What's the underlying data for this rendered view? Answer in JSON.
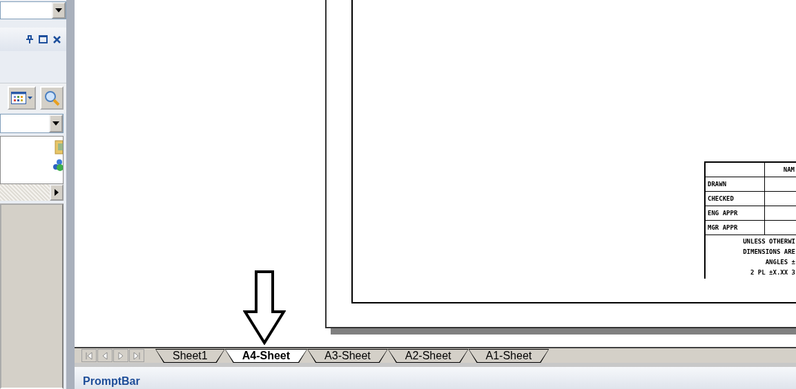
{
  "sheet": {
    "title_block": {
      "header": "NAM",
      "rows": [
        {
          "label": "DRAWN"
        },
        {
          "label": "CHECKED"
        },
        {
          "label": "ENG APPR"
        },
        {
          "label": "MGR APPR"
        }
      ],
      "notes": [
        "UNLESS OTHERWI",
        "DIMENSIONS ARE",
        "ANGLES ±",
        "2 PL ±X.XX 3"
      ]
    }
  },
  "sheet_tabs": [
    {
      "label": "Sheet1",
      "selected": false
    },
    {
      "label": "A4-Sheet",
      "selected": true
    },
    {
      "label": "A3-Sheet",
      "selected": false
    },
    {
      "label": "A2-Sheet",
      "selected": false
    },
    {
      "label": "A1-Sheet",
      "selected": false
    }
  ],
  "prompt_bar": {
    "title": "PromptBar"
  }
}
